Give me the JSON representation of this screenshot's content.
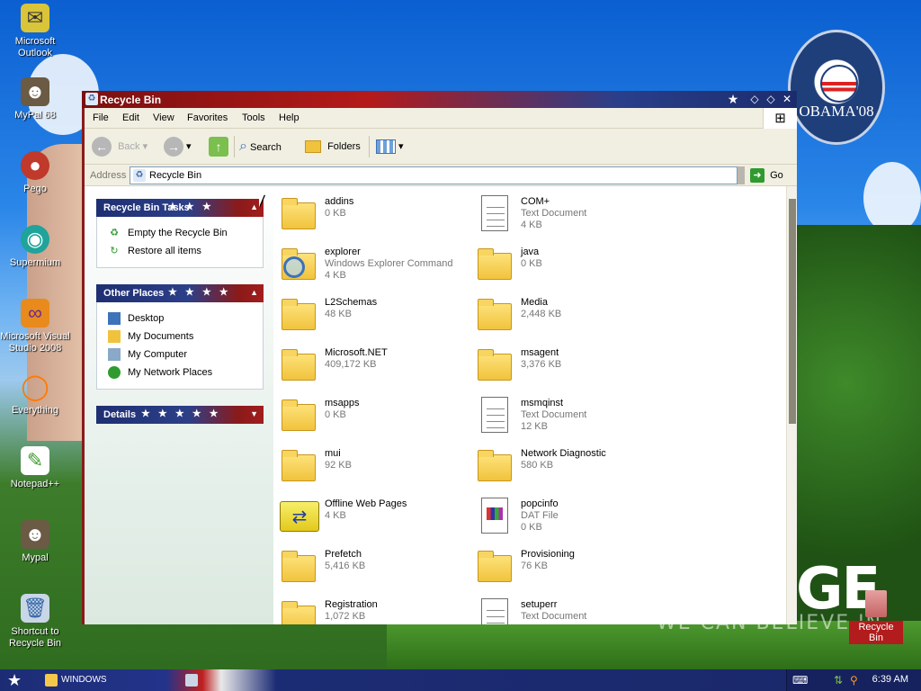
{
  "desktop": {
    "icons": [
      {
        "label": "Microsoft Outlook",
        "icon": "outlook-icon"
      },
      {
        "label": "MyPal 68",
        "icon": "mypal-icon"
      },
      {
        "label": "Pego",
        "icon": "pego-icon"
      },
      {
        "label": "Supermium",
        "icon": "supermium-icon"
      },
      {
        "label": "Microsoft Visual Studio 2008",
        "icon": "visual-studio-icon"
      },
      {
        "label": "Everything",
        "icon": "everything-icon"
      },
      {
        "label": "Notepad++",
        "icon": "notepadpp-icon"
      },
      {
        "label": "Mypal",
        "icon": "mypal-icon"
      },
      {
        "label": "Shortcut to Recycle Bin",
        "icon": "recycle-bin-icon"
      }
    ],
    "recycle_bin_label": "Recycle Bin",
    "logo_text": "OBAMA'08",
    "slogan_big": "GE",
    "slogan_small": "WE CAN BELIEVE IN"
  },
  "window": {
    "title": "Recycle Bin",
    "menu": [
      "File",
      "Edit",
      "View",
      "Favorites",
      "Tools",
      "Help"
    ],
    "toolbar": {
      "back": "Back",
      "search": "Search",
      "folders": "Folders"
    },
    "address_label": "Address",
    "address_value": "Recycle Bin",
    "go_label": "Go"
  },
  "left_pane": {
    "tasks": {
      "title": "Recycle Bin Tasks",
      "items": [
        "Empty the Recycle Bin",
        "Restore all items"
      ]
    },
    "other_places": {
      "title": "Other Places",
      "items": [
        "Desktop",
        "My Documents",
        "My Computer",
        "My Network Places"
      ]
    },
    "details": {
      "title": "Details"
    }
  },
  "files": [
    {
      "name": "addins",
      "type": "",
      "size": "0 KB",
      "kind": "folder"
    },
    {
      "name": "COM+",
      "type": "Text Document",
      "size": "4 KB",
      "kind": "text"
    },
    {
      "name": "explorer",
      "type": "Windows Explorer Command",
      "size": "4 KB",
      "kind": "explorer"
    },
    {
      "name": "java",
      "type": "",
      "size": "0 KB",
      "kind": "folder"
    },
    {
      "name": "L2Schemas",
      "type": "",
      "size": "48 KB",
      "kind": "folder"
    },
    {
      "name": "Media",
      "type": "",
      "size": "2,448 KB",
      "kind": "folder"
    },
    {
      "name": "Microsoft.NET",
      "type": "",
      "size": "409,172 KB",
      "kind": "folder"
    },
    {
      "name": "msagent",
      "type": "",
      "size": "3,376 KB",
      "kind": "folder"
    },
    {
      "name": "msapps",
      "type": "",
      "size": "0 KB",
      "kind": "folder"
    },
    {
      "name": "msmqinst",
      "type": "Text Document",
      "size": "12 KB",
      "kind": "text"
    },
    {
      "name": "mui",
      "type": "",
      "size": "92 KB",
      "kind": "folder"
    },
    {
      "name": "Network Diagnostic",
      "type": "",
      "size": "580 KB",
      "kind": "folder"
    },
    {
      "name": "Offline Web Pages",
      "type": "",
      "size": "4 KB",
      "kind": "special"
    },
    {
      "name": "popcinfo",
      "type": "DAT File",
      "size": "0 KB",
      "kind": "dat"
    },
    {
      "name": "Prefetch",
      "type": "",
      "size": "5,416 KB",
      "kind": "folder"
    },
    {
      "name": "Provisioning",
      "type": "",
      "size": "76 KB",
      "kind": "folder"
    },
    {
      "name": "Registration",
      "type": "",
      "size": "1,072 KB",
      "kind": "folder"
    },
    {
      "name": "setuperr",
      "type": "Text Document",
      "size": "",
      "kind": "text"
    }
  ],
  "taskbar": {
    "task_label": "WINDOWS",
    "clock": "6:39 AM"
  }
}
